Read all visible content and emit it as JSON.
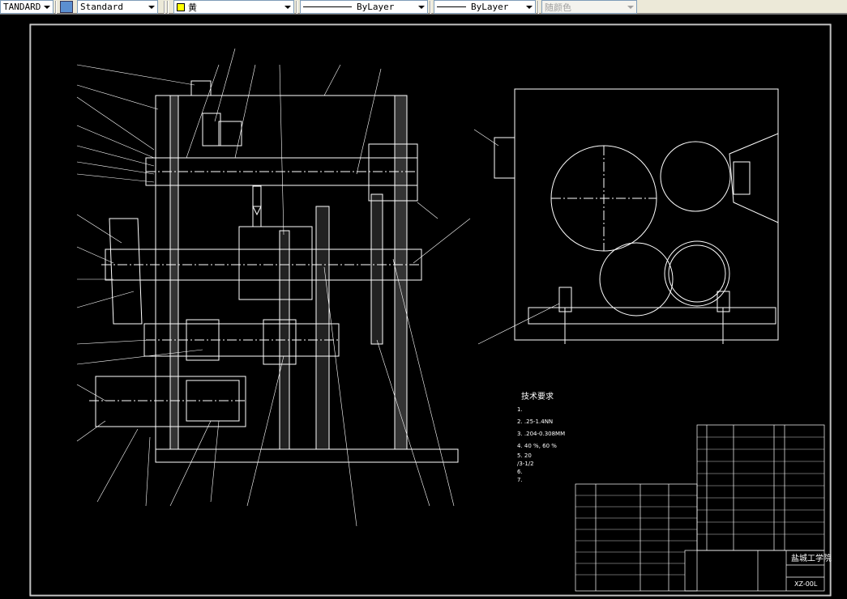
{
  "toolbar": {
    "text_style": "TANDARD",
    "dim_style": "Standard",
    "color": "黄",
    "color_hex": "#ffff00",
    "linetype": "ByLayer",
    "lineweight": "ByLayer",
    "plot_style": "随颜色"
  },
  "drawing": {
    "tech_req_title": "技术要求",
    "tech_req": [
      "1.",
      "2.                .25-1.4NN",
      "3.                .204-0.308MM",
      "4.                40          %,        60  %",
      "5.    20",
      "       /3-1/2",
      "6.",
      "7."
    ],
    "school": "盐城工学院",
    "drawing_no": "XZ-00L"
  }
}
